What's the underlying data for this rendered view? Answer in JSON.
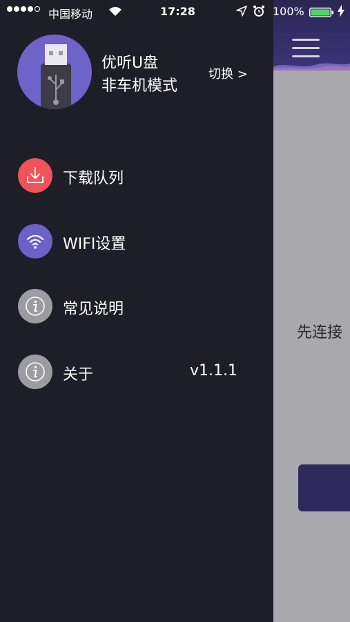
{
  "status_bar": {
    "carrier": "中国移动",
    "time": "17:28",
    "battery": "100%",
    "battery_level": 1.0
  },
  "drawer": {
    "device_name": "优听U盘",
    "device_mode": "非车机模式",
    "switch_label": "切换 >",
    "menu": [
      {
        "label": "下载队列",
        "icon": "download-icon",
        "color": "#f0545a"
      },
      {
        "label": "WIFI设置",
        "icon": "wifi-icon",
        "color": "#6b62c8"
      },
      {
        "label": "常见说明",
        "icon": "info-icon",
        "color": "#9c9ba0"
      },
      {
        "label": "关于",
        "icon": "info-icon",
        "color": "#9c9ba0",
        "extra": "v1.1.1"
      }
    ]
  },
  "main": {
    "connect_text": "先连接"
  },
  "colors": {
    "drawer_bg": "#1e1e28",
    "main_bg": "#a9a8ad",
    "header_bg": "#2e2a5e",
    "avatar_bg": "#6d63c9"
  }
}
